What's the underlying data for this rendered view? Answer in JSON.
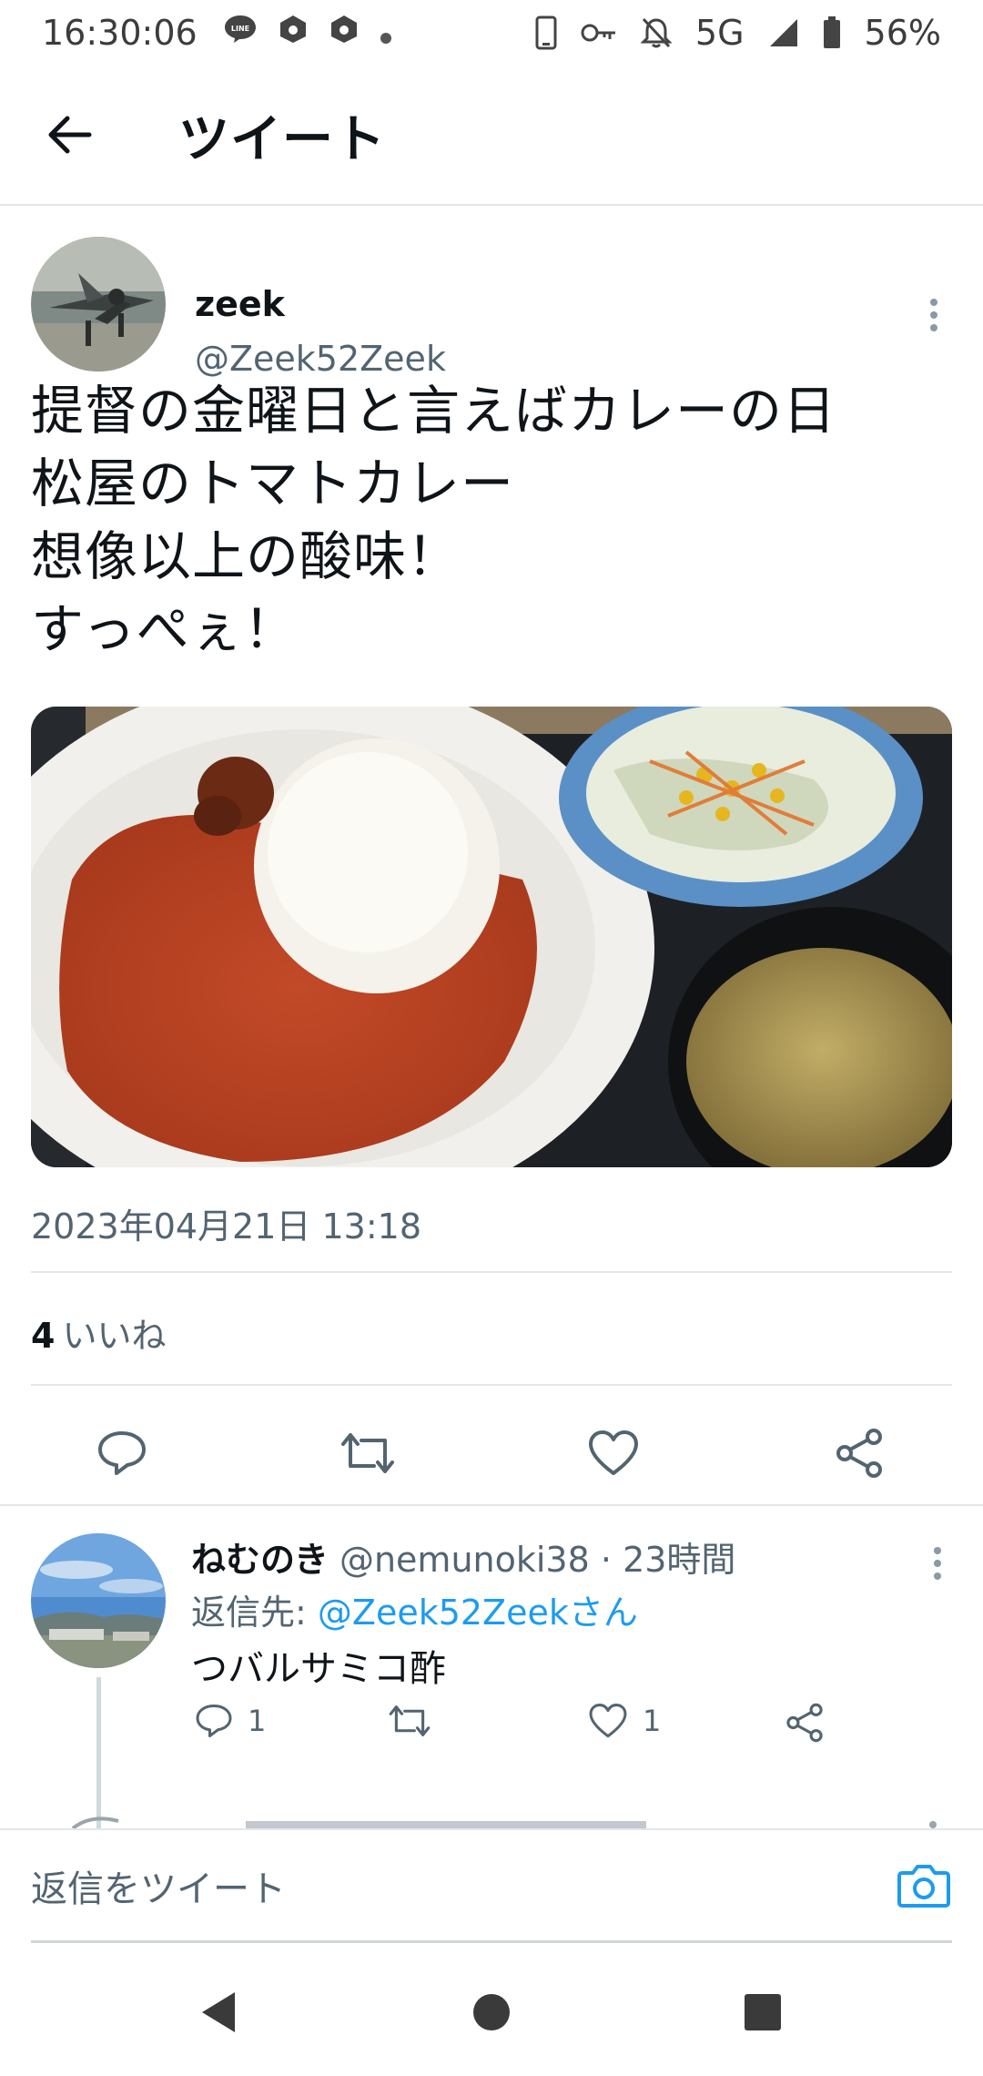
{
  "status_bar": {
    "time": "16:30:06",
    "network": "5G",
    "battery": "56%",
    "left_icons": [
      "line-icon",
      "app-icon",
      "app-icon",
      "dot-icon"
    ],
    "right_icons": [
      "phone-icon",
      "key-icon",
      "mute-icon",
      "signal-icon",
      "battery-icon"
    ]
  },
  "header": {
    "title": "ツイート",
    "back_icon": "arrow-left-icon"
  },
  "tweet": {
    "author_name": "zeek",
    "author_handle": "@Zeek52Zeek",
    "text": "提督の金曜日と言えばカレーの日\n松屋のトマトカレー\n想像以上の酸味！\nすっぺぇ！",
    "timestamp": "2023年04月21日 13:18",
    "likes_count": "4",
    "likes_label": "いいね",
    "actions": [
      "reply-icon",
      "retweet-icon",
      "like-icon",
      "share-icon"
    ]
  },
  "reply": {
    "author_name": "ねむのき",
    "author_handle": "@nemunoki38",
    "separator": "·",
    "time_ago": "23時間",
    "reply_to_label": "返信先:",
    "reply_to_link": "@Zeek52Zeekさん",
    "text": "つバルサミコ酢",
    "reply_count": "1",
    "like_count": "1"
  },
  "compose": {
    "placeholder": "返信をツイート",
    "camera_icon": "camera-icon"
  },
  "colors": {
    "accent": "#1d9bf0",
    "secondary_text": "#536471",
    "divider": "#e4e7ea"
  }
}
